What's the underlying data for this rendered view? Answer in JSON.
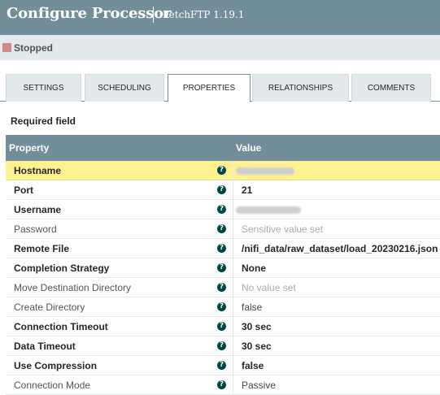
{
  "header": {
    "title": "Configure Processor",
    "subtitle": "FetchFTP 1.19.1"
  },
  "status": {
    "text": "Stopped",
    "color": "#d08a8a"
  },
  "tabs": [
    {
      "label": "SETTINGS",
      "active": false
    },
    {
      "label": "SCHEDULING",
      "active": false
    },
    {
      "label": "PROPERTIES",
      "active": true
    },
    {
      "label": "RELATIONSHIPS",
      "active": false
    },
    {
      "label": "COMMENTS",
      "active": false
    }
  ],
  "required_label": "Required field",
  "grid": {
    "columns": [
      "Property",
      "Value"
    ],
    "rows": [
      {
        "name": "Hostname",
        "value": "",
        "required": true,
        "selected": true
      },
      {
        "name": "Port",
        "value": "21",
        "required": true
      },
      {
        "name": "Username",
        "value": "",
        "required": true
      },
      {
        "name": "Password",
        "value": "Sensitive value set",
        "required": false
      },
      {
        "name": "Remote File",
        "value": "/nifi_data/raw_dataset/load_20230216.json",
        "required": true
      },
      {
        "name": "Completion Strategy",
        "value": "None",
        "required": true
      },
      {
        "name": "Move Destination Directory",
        "value": "No value set",
        "required": false
      },
      {
        "name": "Create Directory",
        "value": "false",
        "required": false
      },
      {
        "name": "Connection Timeout",
        "value": "30 sec",
        "required": true
      },
      {
        "name": "Data Timeout",
        "value": "30 sec",
        "required": true
      },
      {
        "name": "Use Compression",
        "value": "false",
        "required": true
      },
      {
        "name": "Connection Mode",
        "value": "Passive",
        "required": false
      }
    ]
  },
  "help_icon_glyph": "?"
}
